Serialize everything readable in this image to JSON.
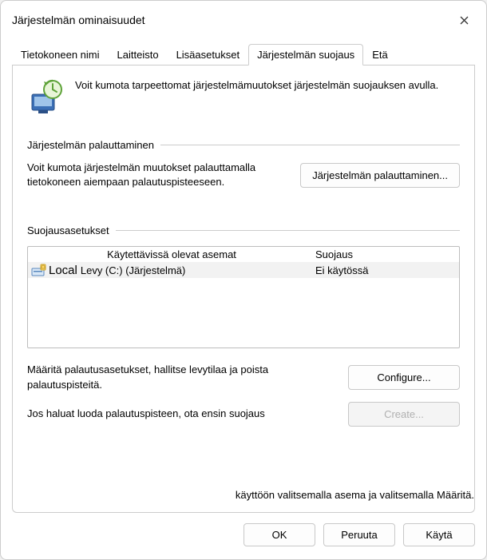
{
  "window": {
    "title": "Järjestelmän ominaisuudet"
  },
  "tabs": {
    "computer_name": "Tietokoneen nimi",
    "hardware": "Laitteisto",
    "advanced": "Lisäasetukset",
    "protection": "Järjestelmän suojaus",
    "remote": "Etä"
  },
  "intro": "Voit kumota tarpeettomat järjestelmämuutokset järjestelmän suojauksen avulla.",
  "restore": {
    "heading": "Järjestelmän palauttaminen",
    "desc": "Voit kumota järjestelmän muutokset palauttamalla tietokoneen aiempaan palautuspisteeseen.",
    "button": "Järjestelmän palauttaminen..."
  },
  "protection": {
    "heading": "Suojausasetukset",
    "col_drives": "Käytettävissä olevat asemat",
    "col_protection": "Suojaus",
    "drives": [
      {
        "local_label": "Local",
        "name": "Levy (C:) (Järjestelmä)",
        "protection": "Ei käytössä"
      }
    ],
    "configure_desc": "Määritä palautusasetukset, hallitse levytilaa ja poista palautuspisteitä.",
    "configure_button": "Configure...",
    "create_desc": "Jos haluat luoda palautuspisteen, ota ensin suojaus",
    "create_button": "Create...",
    "create_note": "käyttöön valitsemalla asema ja valitsemalla Määritä."
  },
  "buttons": {
    "ok": "OK",
    "cancel": "Peruuta",
    "apply": "Käytä"
  }
}
